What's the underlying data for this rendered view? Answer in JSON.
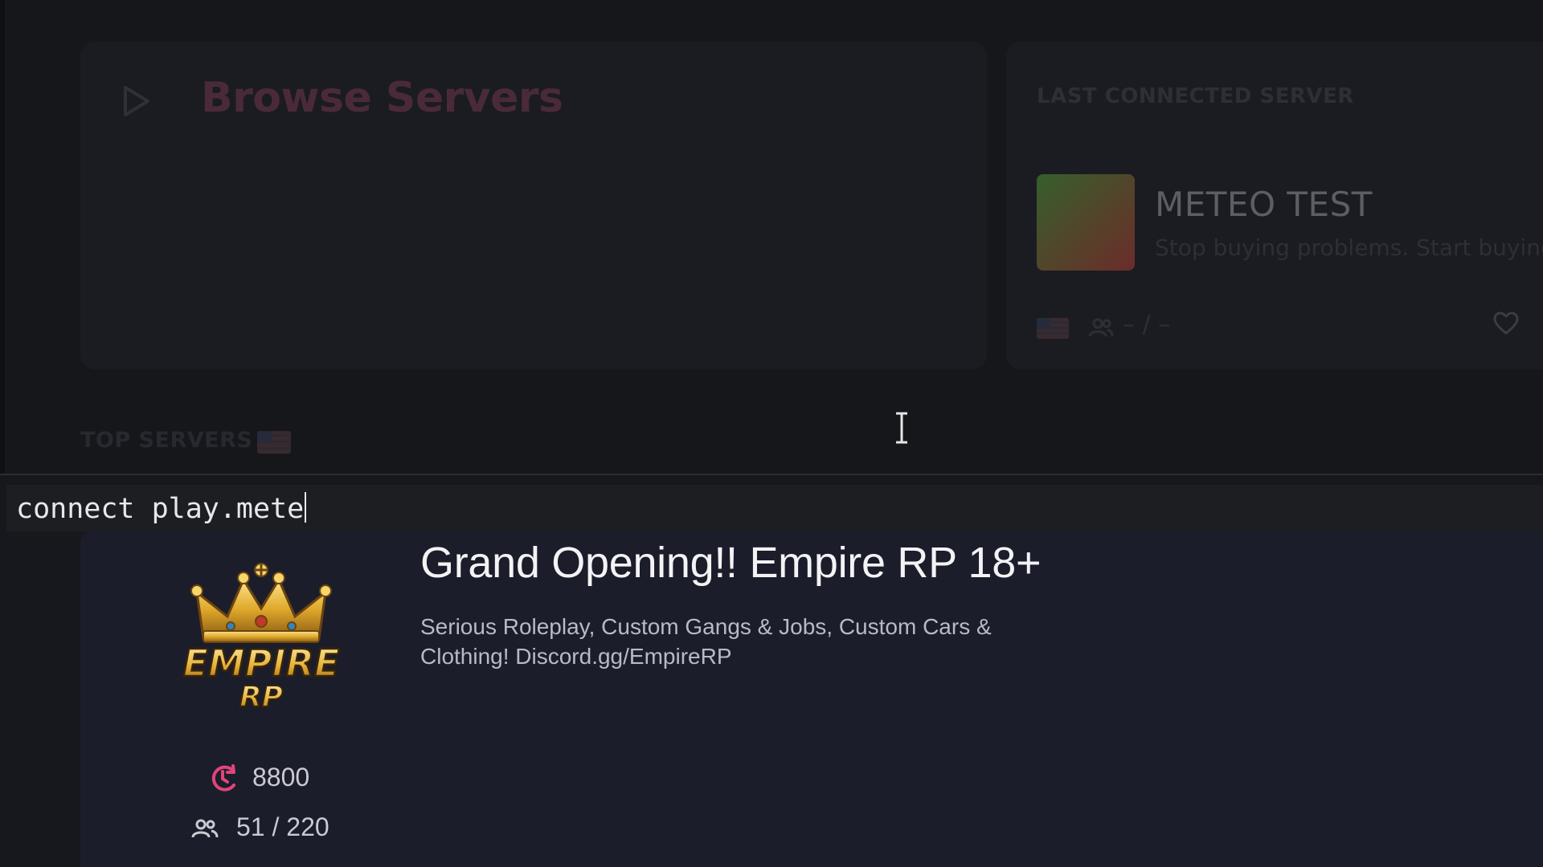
{
  "browse": {
    "title": "Browse Servers"
  },
  "last_connected": {
    "label": "LAST CONNECTED SERVER",
    "server_name": "METEO TEST",
    "server_description": "Stop buying problems. Start buying",
    "players": "– / –"
  },
  "top_servers": {
    "label": "TOP SERVERS"
  },
  "console": {
    "input_value": "connect play.mete"
  },
  "server": {
    "title": "Grand Opening!! Empire RP 18+",
    "description": "Serious Roleplay, Custom Gangs & Jobs, Custom Cars & Clothing! Discord.gg/EmpireRP",
    "boost": "8800",
    "players": "51 / 220",
    "logo_text_main": "EMPIRE",
    "logo_text_sub": "RP"
  },
  "icons": {
    "play": "play-icon",
    "flag": "us-flag-icon",
    "users": "users-icon",
    "heart": "heart-icon",
    "boost": "boost-icon",
    "text_cursor": "text-cursor-icon"
  },
  "colors": {
    "accent_pink": "#e0457b",
    "browse_title_dim": "#4a2a39",
    "background": "#17181d",
    "card_bg": "#1b1d2a"
  }
}
